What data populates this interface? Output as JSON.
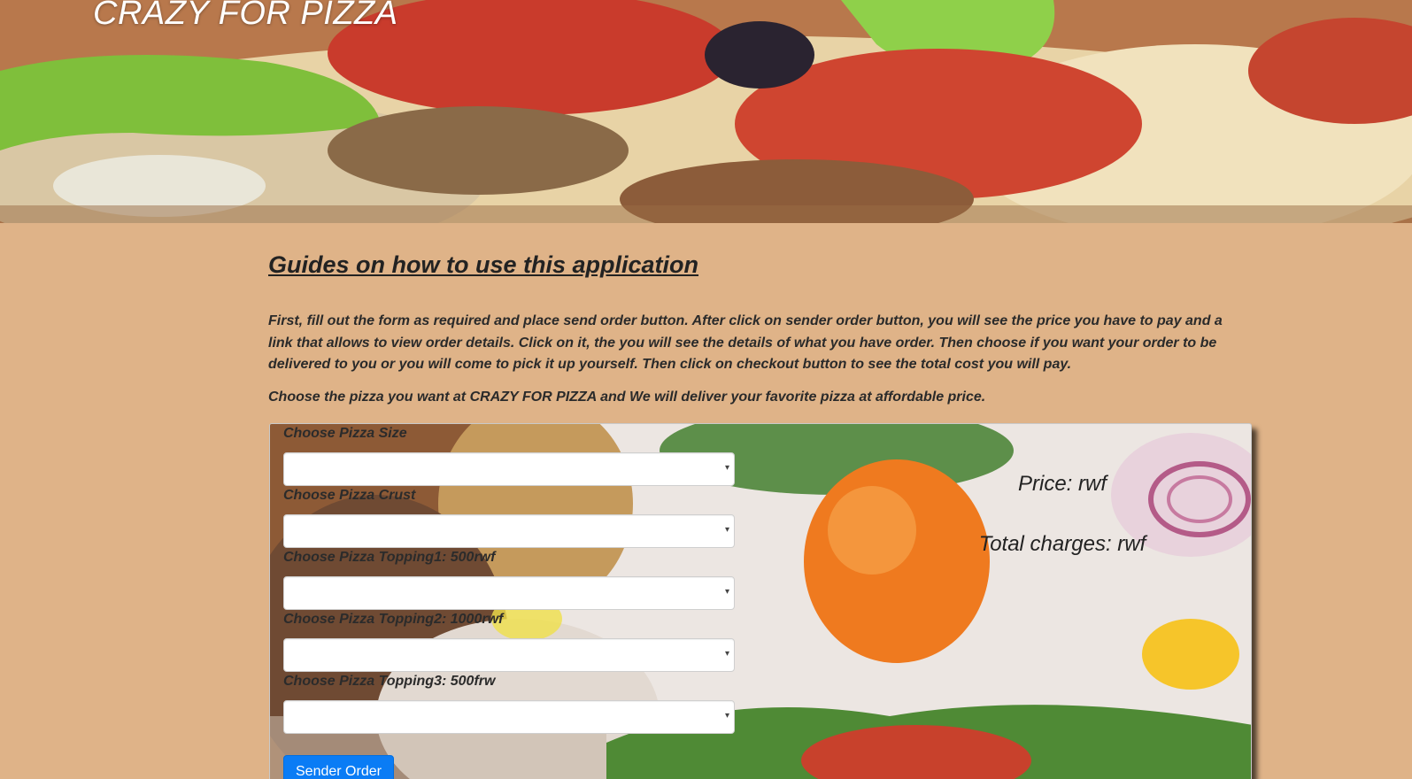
{
  "header": {
    "title": "CRAZY FOR PIZZA"
  },
  "guide": {
    "heading": "Guides on how to use this application",
    "instructions": "First, fill out the form as required and place send order button. After click on sender order button, you will see the price you have to pay and a link that allows to view order details. Click on it, the you will see the details of what you have order. Then choose if you want your order to be delivered to you or you will come to pick it up yourself. Then click on checkout button to see the total cost you will pay.",
    "tagline": "Choose the pizza you want at CRAZY FOR PIZZA and We will deliver your favorite pizza at affordable price."
  },
  "order_form": {
    "fields": [
      {
        "label": "Choose Pizza Size",
        "value": ""
      },
      {
        "label": "Choose Pizza Crust",
        "value": ""
      },
      {
        "label": "Choose Pizza Topping1: 500rwf",
        "value": ""
      },
      {
        "label": "Choose Pizza Topping2: 1000rwf",
        "value": ""
      },
      {
        "label": "Choose Pizza Topping3: 500frw",
        "value": ""
      }
    ],
    "dropdown_caret": "▾",
    "price_text": "Price: rwf",
    "total_text": "Total charges: rwf",
    "submit_label": "Sender Order"
  },
  "colors": {
    "page_background": "#dfb388",
    "button_primary": "#0a7cf5"
  }
}
